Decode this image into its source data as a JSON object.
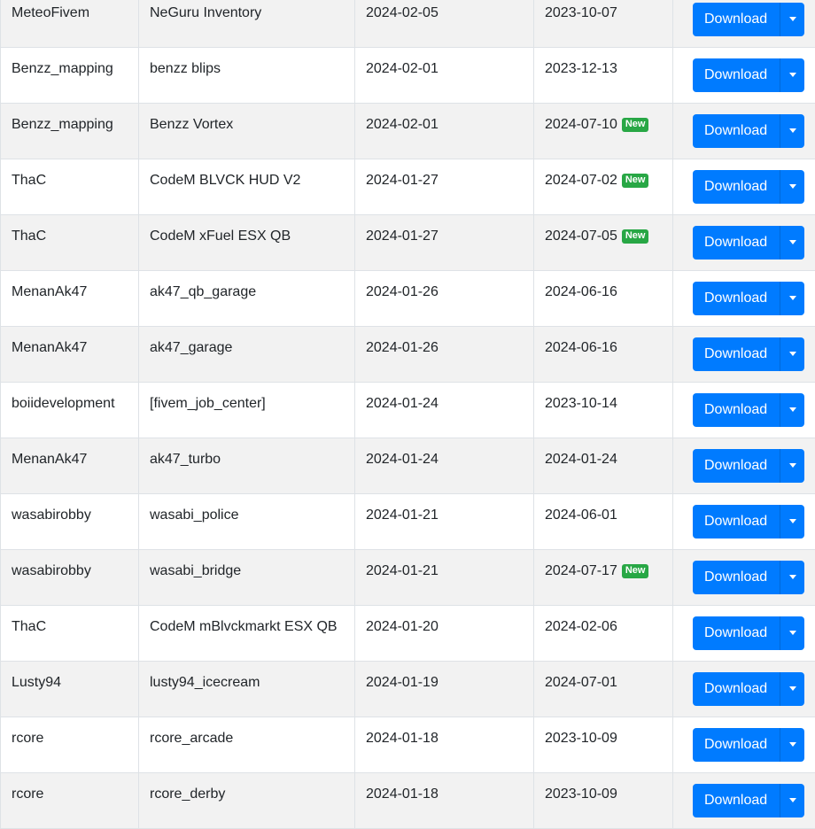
{
  "table": {
    "action_label": "Download",
    "new_badge_label": "New",
    "rows": [
      {
        "author": "MeteoFivem",
        "name": "NeGuru Inventory",
        "created": "2024-02-05",
        "updated": "2023-10-07",
        "is_new": false
      },
      {
        "author": "Benzz_mapping",
        "name": "benzz blips",
        "created": "2024-02-01",
        "updated": "2023-12-13",
        "is_new": false
      },
      {
        "author": "Benzz_mapping",
        "name": "Benzz Vortex",
        "created": "2024-02-01",
        "updated": "2024-07-10",
        "is_new": true
      },
      {
        "author": "ThaC",
        "name": "CodeM BLVCK HUD V2",
        "created": "2024-01-27",
        "updated": "2024-07-02",
        "is_new": true
      },
      {
        "author": "ThaC",
        "name": "CodeM xFuel ESX QB",
        "created": "2024-01-27",
        "updated": "2024-07-05",
        "is_new": true
      },
      {
        "author": "MenanAk47",
        "name": "ak47_qb_garage",
        "created": "2024-01-26",
        "updated": "2024-06-16",
        "is_new": false
      },
      {
        "author": "MenanAk47",
        "name": "ak47_garage",
        "created": "2024-01-26",
        "updated": "2024-06-16",
        "is_new": false
      },
      {
        "author": "boiidevelopment",
        "name": "[fivem_job_center]",
        "created": "2024-01-24",
        "updated": "2023-10-14",
        "is_new": false
      },
      {
        "author": "MenanAk47",
        "name": "ak47_turbo",
        "created": "2024-01-24",
        "updated": "2024-01-24",
        "is_new": false
      },
      {
        "author": "wasabirobby",
        "name": "wasabi_police",
        "created": "2024-01-21",
        "updated": "2024-06-01",
        "is_new": false
      },
      {
        "author": "wasabirobby",
        "name": "wasabi_bridge",
        "created": "2024-01-21",
        "updated": "2024-07-17",
        "is_new": true
      },
      {
        "author": "ThaC",
        "name": "CodeM mBlvckmarkt ESX QB",
        "created": "2024-01-20",
        "updated": "2024-02-06",
        "is_new": false
      },
      {
        "author": "Lusty94",
        "name": "lusty94_icecream",
        "created": "2024-01-19",
        "updated": "2024-07-01",
        "is_new": false
      },
      {
        "author": "rcore",
        "name": "rcore_arcade",
        "created": "2024-01-18",
        "updated": "2023-10-09",
        "is_new": false
      },
      {
        "author": "rcore",
        "name": "rcore_derby",
        "created": "2024-01-18",
        "updated": "2023-10-09",
        "is_new": false
      }
    ]
  },
  "colors": {
    "primary": "#007bff",
    "badge_new": "#28a745",
    "stripe": "#f2f2f2",
    "border": "#dee2e6"
  }
}
